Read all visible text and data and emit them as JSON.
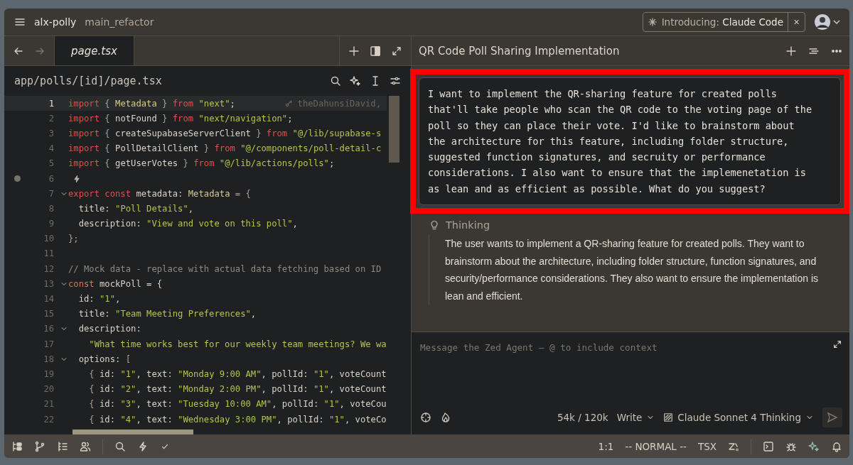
{
  "titlebar": {
    "project": "alx-polly",
    "branch": "main_refactor",
    "banner": {
      "prefix": "Introducing:",
      "name": "Claude Code",
      "close": "×"
    }
  },
  "editor": {
    "tab": {
      "label": "page.tsx",
      "selected": true
    },
    "path": "app/polls/[id]/page.tsx",
    "blame": "theDahunsiDavid,",
    "lines": [
      {
        "number": "1",
        "current": true,
        "fold": false,
        "dot": false,
        "tokens": [
          {
            "kind": "kw",
            "text": "import"
          },
          {
            "kind": "punct",
            "text": " { "
          },
          {
            "kind": "type",
            "text": "Metadata"
          },
          {
            "kind": "punct",
            "text": " } "
          },
          {
            "kind": "kw",
            "text": "from"
          },
          {
            "kind": "str",
            "text": " \"next\""
          },
          {
            "kind": "plain",
            "text": ";"
          }
        ]
      },
      {
        "number": "2",
        "current": false,
        "fold": false,
        "dot": false,
        "tokens": [
          {
            "kind": "kw",
            "text": "import"
          },
          {
            "kind": "punct",
            "text": " { "
          },
          {
            "kind": "plain",
            "text": "notFound"
          },
          {
            "kind": "punct",
            "text": " } "
          },
          {
            "kind": "kw",
            "text": "from"
          },
          {
            "kind": "str",
            "text": " \"next/navigation\""
          },
          {
            "kind": "plain",
            "text": ";"
          }
        ]
      },
      {
        "number": "3",
        "current": false,
        "fold": false,
        "dot": false,
        "tokens": [
          {
            "kind": "kw",
            "text": "import"
          },
          {
            "kind": "punct",
            "text": " { "
          },
          {
            "kind": "plain",
            "text": "createSupabaseServerClient"
          },
          {
            "kind": "punct",
            "text": " } "
          },
          {
            "kind": "kw",
            "text": "from"
          },
          {
            "kind": "str",
            "text": " \"@/lib/supabase-s"
          }
        ]
      },
      {
        "number": "4",
        "current": false,
        "fold": false,
        "dot": false,
        "tokens": [
          {
            "kind": "kw",
            "text": "import"
          },
          {
            "kind": "punct",
            "text": " { "
          },
          {
            "kind": "plain",
            "text": "PollDetailClient"
          },
          {
            "kind": "punct",
            "text": " } "
          },
          {
            "kind": "kw",
            "text": "from"
          },
          {
            "kind": "str",
            "text": " \"@/components/poll-detail-c"
          }
        ]
      },
      {
        "number": "5",
        "current": false,
        "fold": false,
        "dot": false,
        "tokens": [
          {
            "kind": "kw",
            "text": "import"
          },
          {
            "kind": "punct",
            "text": " { "
          },
          {
            "kind": "plain",
            "text": "getUserVotes"
          },
          {
            "kind": "punct",
            "text": " } "
          },
          {
            "kind": "kw",
            "text": "from"
          },
          {
            "kind": "str",
            "text": " \"@/lib/actions/polls\""
          },
          {
            "kind": "plain",
            "text": ";"
          }
        ]
      },
      {
        "number": "6",
        "current": false,
        "fold": false,
        "dot": true
      },
      {
        "number": "7",
        "current": false,
        "fold": true,
        "dot": false,
        "tokens": [
          {
            "kind": "kw",
            "text": "export const"
          },
          {
            "kind": "plain",
            "text": " metadata: "
          },
          {
            "kind": "type",
            "text": "Metadata"
          },
          {
            "kind": "punct",
            "text": " = {"
          }
        ]
      },
      {
        "number": "8",
        "current": false,
        "fold": false,
        "dot": false,
        "tokens": [
          {
            "kind": "plain",
            "text": "  title: "
          },
          {
            "kind": "str",
            "text": "\"Poll Details\""
          },
          {
            "kind": "plain",
            "text": ","
          }
        ]
      },
      {
        "number": "9",
        "current": false,
        "fold": false,
        "dot": false,
        "tokens": [
          {
            "kind": "plain",
            "text": "  description: "
          },
          {
            "kind": "str",
            "text": "\"View and vote on this poll\""
          },
          {
            "kind": "plain",
            "text": ","
          }
        ]
      },
      {
        "number": "10",
        "current": false,
        "fold": false,
        "dot": false,
        "tokens": [
          {
            "kind": "punct",
            "text": "};"
          }
        ]
      },
      {
        "number": "11",
        "current": false,
        "fold": false,
        "dot": false
      },
      {
        "number": "12",
        "current": false,
        "fold": false,
        "dot": false,
        "tokens": [
          {
            "kind": "comment",
            "text": "// Mock data - replace with actual data fetching based on ID"
          }
        ]
      },
      {
        "number": "13",
        "current": false,
        "fold": true,
        "dot": false,
        "tokens": [
          {
            "kind": "kw2",
            "text": "const"
          },
          {
            "kind": "plain",
            "text": " mockPoll = {"
          }
        ]
      },
      {
        "number": "14",
        "current": false,
        "fold": false,
        "dot": false,
        "tokens": [
          {
            "kind": "plain",
            "text": "  id: "
          },
          {
            "kind": "str",
            "text": "\"1\""
          },
          {
            "kind": "plain",
            "text": ","
          }
        ]
      },
      {
        "number": "15",
        "current": false,
        "fold": false,
        "dot": false,
        "tokens": [
          {
            "kind": "plain",
            "text": "  title: "
          },
          {
            "kind": "str",
            "text": "\"Team Meeting Preferences\""
          },
          {
            "kind": "plain",
            "text": ","
          }
        ]
      },
      {
        "number": "16",
        "current": false,
        "fold": true,
        "dot": false,
        "tokens": [
          {
            "kind": "plain",
            "text": "  description:"
          }
        ]
      },
      {
        "number": "17",
        "current": false,
        "fold": false,
        "dot": false,
        "tokens": [
          {
            "kind": "str",
            "text": "    \"What time works best for our weekly team meetings? We wa"
          }
        ]
      },
      {
        "number": "18",
        "current": false,
        "fold": true,
        "dot": false,
        "tokens": [
          {
            "kind": "plain",
            "text": "  options: "
          },
          {
            "kind": "punct",
            "text": "["
          }
        ]
      },
      {
        "number": "19",
        "current": false,
        "fold": false,
        "dot": false,
        "tokens": [
          {
            "kind": "punct",
            "text": "    { "
          },
          {
            "kind": "plain",
            "text": "id: "
          },
          {
            "kind": "str",
            "text": "\"1\""
          },
          {
            "kind": "plain",
            "text": ", text: "
          },
          {
            "kind": "str",
            "text": "\"Monday 9:00 AM\""
          },
          {
            "kind": "plain",
            "text": ", pollId: "
          },
          {
            "kind": "str",
            "text": "\"1\""
          },
          {
            "kind": "plain",
            "text": ", voteCount"
          }
        ]
      },
      {
        "number": "20",
        "current": false,
        "fold": false,
        "dot": false,
        "tokens": [
          {
            "kind": "punct",
            "text": "    { "
          },
          {
            "kind": "plain",
            "text": "id: "
          },
          {
            "kind": "str",
            "text": "\"2\""
          },
          {
            "kind": "plain",
            "text": ", text: "
          },
          {
            "kind": "str",
            "text": "\"Monday 2:00 PM\""
          },
          {
            "kind": "plain",
            "text": ", pollId: "
          },
          {
            "kind": "str",
            "text": "\"1\""
          },
          {
            "kind": "plain",
            "text": ", voteCount"
          }
        ]
      },
      {
        "number": "21",
        "current": false,
        "fold": false,
        "dot": false,
        "tokens": [
          {
            "kind": "punct",
            "text": "    { "
          },
          {
            "kind": "plain",
            "text": "id: "
          },
          {
            "kind": "str",
            "text": "\"3\""
          },
          {
            "kind": "plain",
            "text": ", text: "
          },
          {
            "kind": "str",
            "text": "\"Tuesday 10:00 AM\""
          },
          {
            "kind": "plain",
            "text": ", pollId: "
          },
          {
            "kind": "str",
            "text": "\"1\""
          },
          {
            "kind": "plain",
            "text": ", voteCou"
          }
        ]
      },
      {
        "number": "22",
        "current": false,
        "fold": false,
        "dot": false,
        "tokens": [
          {
            "kind": "punct",
            "text": "    { "
          },
          {
            "kind": "plain",
            "text": "id: "
          },
          {
            "kind": "str",
            "text": "\"4\""
          },
          {
            "kind": "plain",
            "text": ", text: "
          },
          {
            "kind": "str",
            "text": "\"Wednesday 3:00 PM\""
          },
          {
            "kind": "plain",
            "text": ", pollId: "
          },
          {
            "kind": "str",
            "text": "\"1\""
          },
          {
            "kind": "plain",
            "text": ", voteCo"
          }
        ]
      }
    ]
  },
  "agent": {
    "title": "QR Code Poll Sharing Implementation",
    "message": "I want to implement the QR-sharing feature for created polls that'll take people who scan the QR code to the voting page of the poll so they can place their vote. I'd like to brainstorm about the architecture for this feature, including folder structure, suggested function signatures, and secruity or performance considerations. I also want to ensure that the implemenetation is as lean and as efficient as possible. What do you suggest?",
    "thinking": {
      "label": "Thinking",
      "text": "The user wants to implement a QR-sharing feature for created polls. They want to brainstorm about the architecture, including folder structure, function signatures, and security/performance considerations. They also want to ensure the implementation is lean and efficient."
    },
    "input": {
      "placeholder": "Message the Zed Agent — @ to include context"
    },
    "tokens": "54k / 120k",
    "mode": "Write",
    "model": "Claude Sonnet 4 Thinking"
  },
  "status_bar": {
    "position": "1:1",
    "vim_mode": "-- NORMAL --",
    "language": "TSX"
  }
}
